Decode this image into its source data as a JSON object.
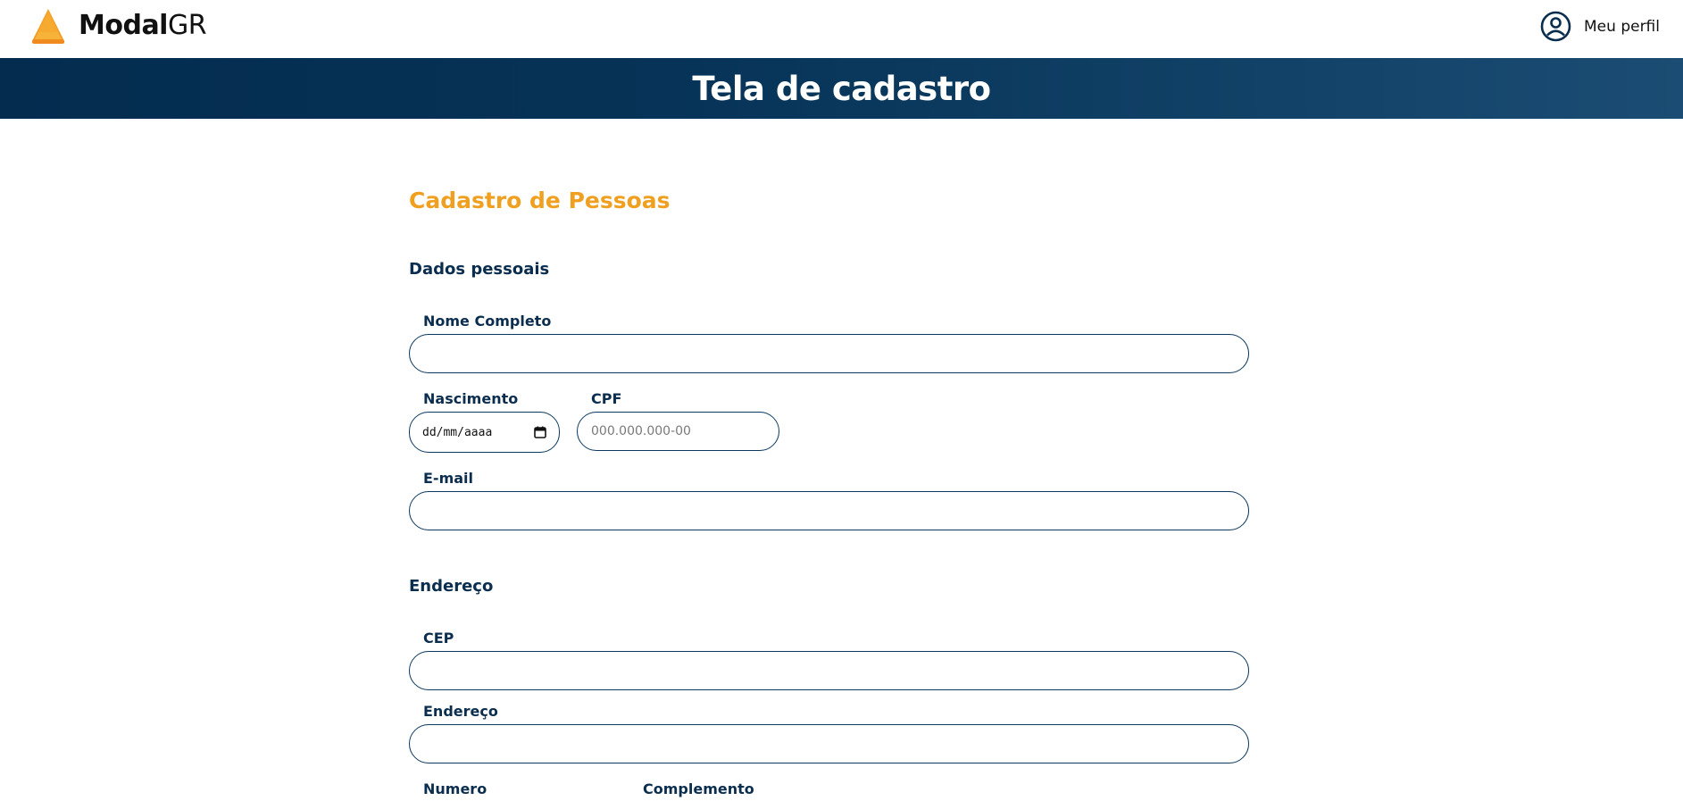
{
  "header": {
    "logo_bold": "Modal",
    "logo_regular": "GR",
    "profile_label": "Meu perfil",
    "icons": {
      "logo": "cone-logo-icon",
      "profile": "user-circle-icon"
    }
  },
  "banner": {
    "title": "Tela de cadastro"
  },
  "form": {
    "title": "Cadastro de Pessoas",
    "personal_section": "Dados pessoais",
    "address_section": "Endereço",
    "fields": {
      "nome_completo": {
        "label": "Nome Completo",
        "value": "",
        "placeholder": ""
      },
      "nascimento": {
        "label": "Nascimento",
        "value": "dd/mm/aaaa"
      },
      "cpf": {
        "label": "CPF",
        "value": "",
        "placeholder": "000.000.000-00"
      },
      "email": {
        "label": "E-mail",
        "value": "",
        "placeholder": ""
      },
      "cep": {
        "label": "CEP",
        "value": "",
        "placeholder": ""
      },
      "endereco": {
        "label": "Endereço",
        "value": "",
        "placeholder": ""
      },
      "numero": {
        "label": "Numero"
      },
      "complemento": {
        "label": "Complemento"
      }
    }
  },
  "colors": {
    "brand_orange": "#f0a021",
    "navy": "#0b2e4f",
    "banner_dark": "#042c4f",
    "banner_light": "#1b4c73"
  }
}
